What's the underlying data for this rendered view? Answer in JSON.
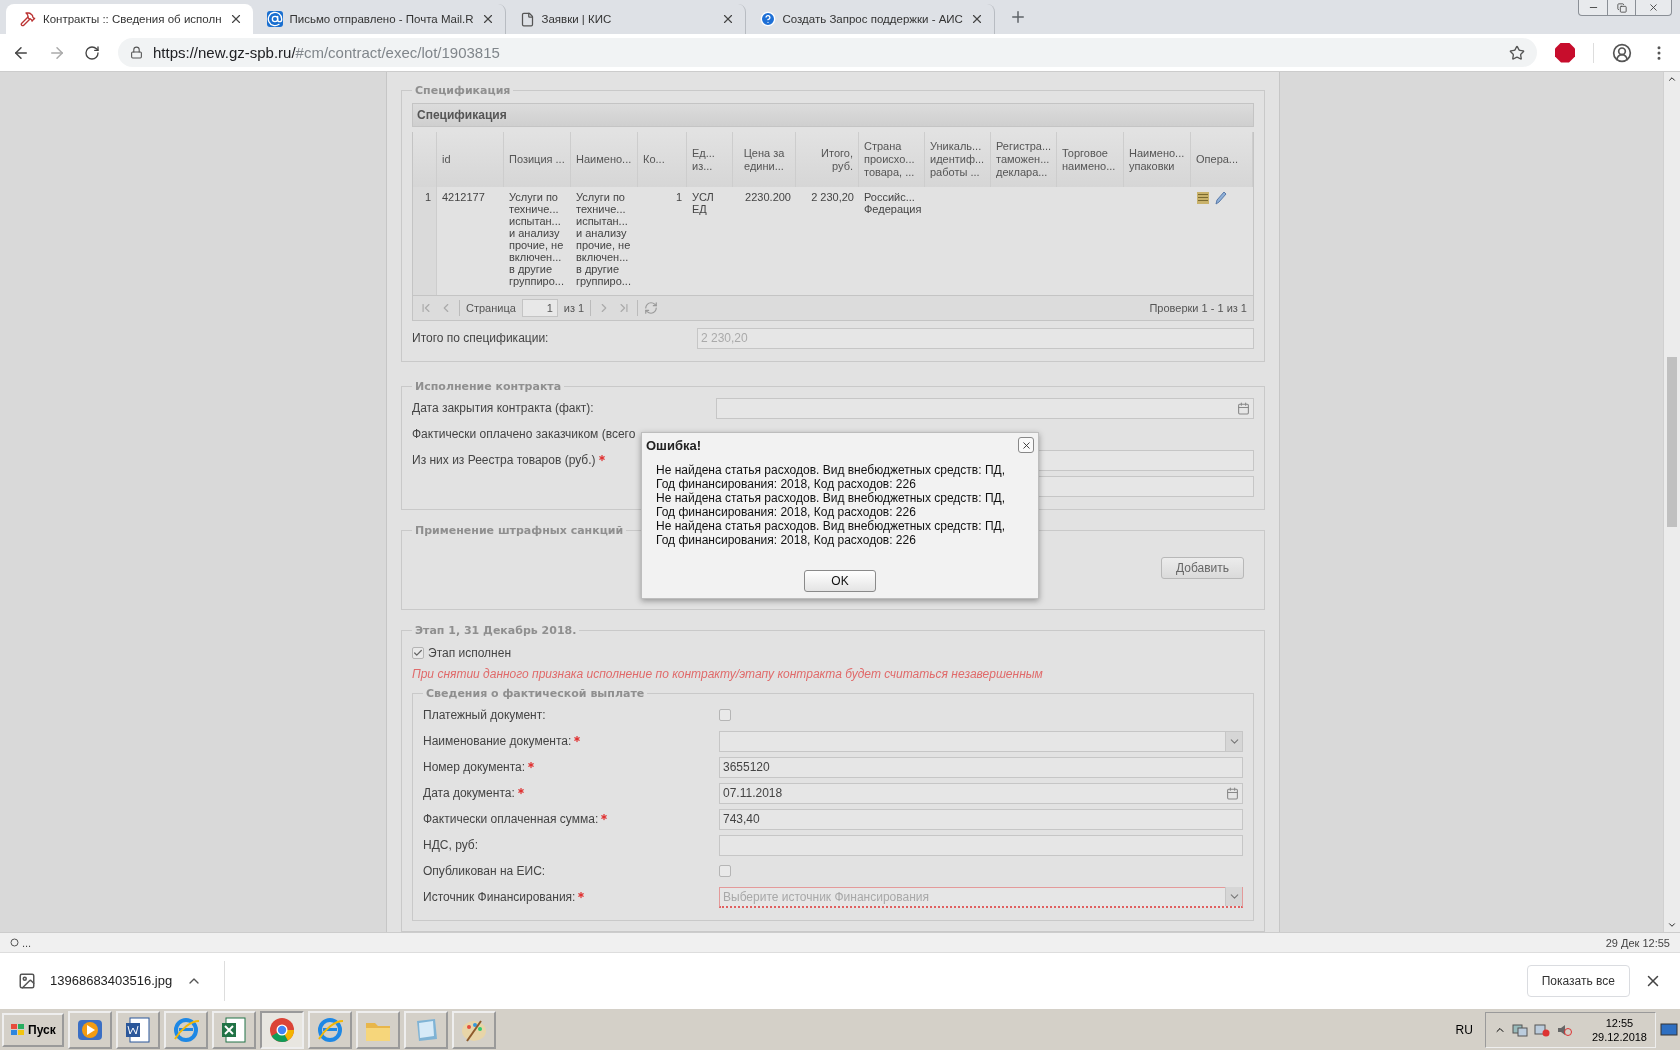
{
  "browser": {
    "tabs": [
      {
        "title": "Контракты :: Сведения об исполн",
        "kind": "tools",
        "selected": true
      },
      {
        "title": "Письмо отправлено - Почта Mail.R",
        "kind": "mail",
        "selected": false
      },
      {
        "title": "Заявки | КИС",
        "kind": "page",
        "selected": false
      },
      {
        "title": "Создать Запрос поддержки - АИС",
        "kind": "help",
        "selected": false
      }
    ],
    "url": {
      "host": "https://new.gz-spb.ru/",
      "path": "#cm/contract/exec/lot/1903815"
    }
  },
  "specification": {
    "legend": "Спецификация",
    "grid_title": "Спецификация",
    "columns": [
      {
        "label": "id",
        "kind": "text"
      },
      {
        "label": "Позиция ...",
        "kind": "text"
      },
      {
        "label": "Наимено...",
        "kind": "text"
      },
      {
        "label": "Ко...",
        "kind": "text"
      },
      {
        "label": "Ед...\nиз...",
        "kind": "text"
      },
      {
        "label": "Цена за\nедини...",
        "kind": "text"
      },
      {
        "label": "Итого,\nруб.",
        "kind": "text"
      },
      {
        "label": "Страна\nпроисхо...\nтовара, ...",
        "kind": "text"
      },
      {
        "label": "Уникаль...\nидентиф...\nработы ...",
        "kind": "text"
      },
      {
        "label": "Регистра...\nтаможен...\nдеклара...",
        "kind": "text"
      },
      {
        "label": "Торговое\nнаимено...",
        "kind": "text"
      },
      {
        "label": "Наимено...\nупаковки",
        "kind": "text"
      },
      {
        "label": "Опера...",
        "kind": "actions"
      }
    ],
    "rows": [
      {
        "number": "1",
        "cells": [
          "4212177",
          "Услуги по\nтехниче...\nиспытан...\nи анализу\nпрочие, не\nвключен...\nв другие\nгруппиро...",
          "Услуги по\nтехниче...\nиспытан...\nи анализу\nпрочие, не\nвключен...\nв другие\nгруппиро...",
          "1",
          "УСЛ ЕД",
          "2230.200",
          "2 230,20",
          "Российс...\nФедерация"
        ]
      }
    ],
    "pager": {
      "page_label": "Страница",
      "page": "1",
      "of": "из 1",
      "summary": "Проверки 1 - 1 из 1"
    },
    "total": {
      "label": "Итого по спецификации:",
      "value": "2 230,20",
      "disabled": true
    }
  },
  "execution": {
    "legend": "Исполнение контракта",
    "fields": [
      {
        "label": "Дата закрытия контракта (факт):",
        "kind": "date",
        "required": false
      },
      {
        "label": "Фактически оплачено заказчиком (всего",
        "kind": "none",
        "required": false
      },
      {
        "label": "Из них из Реестра товаров (руб.)",
        "kind": "text",
        "required": true
      },
      {
        "kind": "text",
        "required": false
      }
    ]
  },
  "penalties": {
    "legend": "Применение штрафных санкций",
    "button": "Добавить"
  },
  "stage": {
    "legend": "Этап 1, 31 Декабрь 2018.",
    "done": {
      "label": "Этап исполнен",
      "checked": true
    },
    "warning": "При снятии данного признака исполнение по контракту/этапу контракта будет считаться незавершенным",
    "payment": {
      "legend": "Сведения о фактической выплате",
      "fields": [
        {
          "label": "Платежный документ:",
          "kind": "checkbox",
          "checked": false,
          "required": false
        },
        {
          "label": "Наименование документа:",
          "kind": "select",
          "required": true
        },
        {
          "label": "Номер документа:",
          "kind": "text",
          "value": "3655120",
          "required": true
        },
        {
          "label": "Дата документа:",
          "kind": "date",
          "value": "07.11.2018",
          "required": true
        },
        {
          "label": "Фактически оплаченная сумма:",
          "kind": "text",
          "value": "743,40",
          "required": true
        },
        {
          "label": "НДС, руб:",
          "kind": "text",
          "required": false
        },
        {
          "label": "Опубликован на ЕИС:",
          "kind": "checkbox",
          "checked": false,
          "required": false
        },
        {
          "label": "Источник Финансирования:",
          "kind": "select",
          "placeholder": "Выберите источник Финансирования",
          "invalid": true,
          "required": true
        }
      ]
    }
  },
  "dialog": {
    "title": "Ошибка!",
    "lines": [
      "Не найдена статья расходов. Вид внебюджетных средств: ПД,",
      "Год финансирования: 2018, Код расходов: 226",
      "Не найдена статья расходов. Вид внебюджетных средств: ПД,",
      "Год финансирования: 2018, Код расходов: 226",
      "Не найдена статья расходов. Вид внебюджетных средств: ПД,",
      "Год финансирования: 2018, Код расходов: 226"
    ],
    "button": "OK"
  },
  "status_bar": {
    "left": "...",
    "right": "29 Дек 12:55"
  },
  "downloads": {
    "file": "13968683403516.jpg",
    "show_all": "Показать все"
  },
  "taskbar": {
    "start": "Пуск",
    "apps": [
      {
        "kind": "media",
        "selected": false
      },
      {
        "kind": "word",
        "selected": false
      },
      {
        "kind": "ie",
        "selected": false
      },
      {
        "kind": "excel",
        "selected": false
      },
      {
        "kind": "chrome",
        "selected": true
      },
      {
        "kind": "ie",
        "selected": false
      },
      {
        "kind": "folder",
        "selected": false
      },
      {
        "kind": "notebook",
        "selected": false
      },
      {
        "kind": "paint",
        "selected": false
      }
    ],
    "language": "RU",
    "time": "12:55",
    "date": "29.12.2018"
  }
}
